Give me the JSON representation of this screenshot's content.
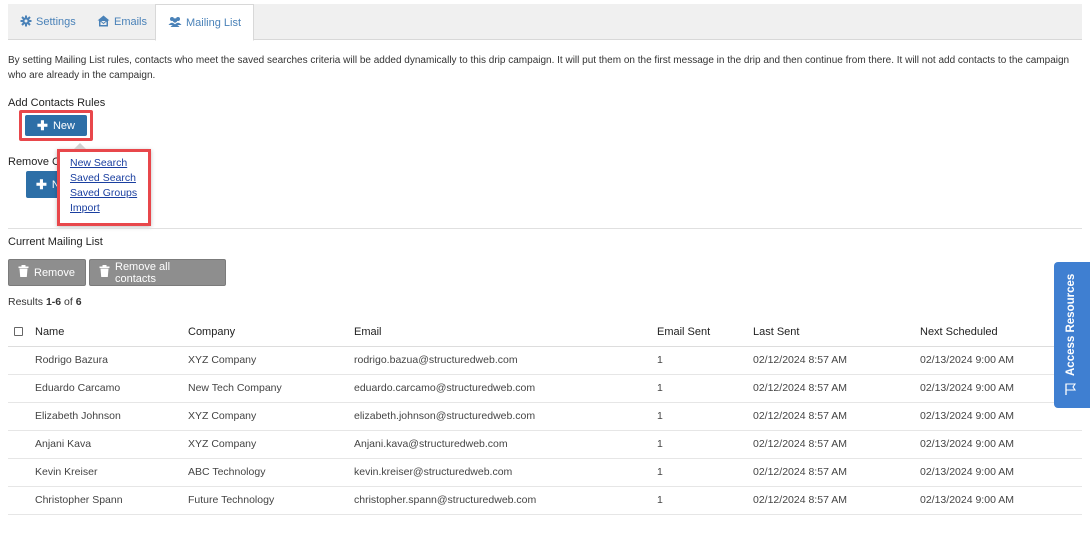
{
  "tabs": [
    {
      "label": "Settings"
    },
    {
      "label": "Emails"
    },
    {
      "label": "Mailing List"
    }
  ],
  "description": "By setting Mailing List rules, contacts who meet the saved searches criteria will be added dynamically to this drip campaign. It will put them on the first message in the drip and then continue from there. It will not add contacts to the campaign who are already in the campaign.",
  "add_rules": {
    "heading": "Add Contacts Rules",
    "new_label": "New"
  },
  "remove_rules": {
    "heading_visible": "Remove C",
    "new_label": "N"
  },
  "dropdown": {
    "items": [
      "New Search",
      "Saved Search",
      "Saved Groups",
      "Import"
    ]
  },
  "mailing_list": {
    "heading": "Current Mailing List",
    "remove_label": "Remove",
    "remove_all_label": "Remove all contacts",
    "results_prefix": "Results ",
    "results_range": "1-6",
    "results_of": " of ",
    "results_total": "6",
    "columns": [
      "Name",
      "Company",
      "Email",
      "Email Sent",
      "Last Sent",
      "Next Scheduled"
    ],
    "rows": [
      {
        "name": "Rodrigo Bazura",
        "company": "XYZ Company",
        "email": "rodrigo.bazua@structuredweb.com",
        "sent": "1",
        "last": "02/12/2024 8:57 AM",
        "next": "02/13/2024 9:00 AM"
      },
      {
        "name": "Eduardo Carcamo",
        "company": "New Tech Company",
        "email": "eduardo.carcamo@structuredweb.com",
        "sent": "1",
        "last": "02/12/2024 8:57 AM",
        "next": "02/13/2024 9:00 AM"
      },
      {
        "name": "Elizabeth Johnson",
        "company": "XYZ Company",
        "email": "elizabeth.johnson@structuredweb.com",
        "sent": "1",
        "last": "02/12/2024 8:57 AM",
        "next": "02/13/2024 9:00 AM"
      },
      {
        "name": "Anjani Kava",
        "company": "XYZ Company",
        "email": "Anjani.kava@structuredweb.com",
        "sent": "1",
        "last": "02/12/2024 8:57 AM",
        "next": "02/13/2024 9:00 AM"
      },
      {
        "name": "Kevin Kreiser",
        "company": "ABC Technology",
        "email": "kevin.kreiser@structuredweb.com",
        "sent": "1",
        "last": "02/12/2024 8:57 AM",
        "next": "02/13/2024 9:00 AM"
      },
      {
        "name": "Christopher Spann",
        "company": "Future Technology",
        "email": "christopher.spann@structuredweb.com",
        "sent": "1",
        "last": "02/12/2024 8:57 AM",
        "next": "02/13/2024 9:00 AM"
      }
    ]
  },
  "side_tab": {
    "label": "Access Resources"
  },
  "icons": {
    "settings": "gear-icon",
    "emails": "house-envelope-icon",
    "mailing_list": "users-icon",
    "new": "plus-icon",
    "remove": "trash-icon",
    "side_tab": "flag-icon"
  },
  "colors": {
    "accent_blue": "#2d6fa7",
    "tab_link": "#4a82b8",
    "highlight_red": "#e8474b",
    "gray_button": "#8e8e8e",
    "side_tab": "#3f7fd1",
    "dropdown_link": "#1a3fa0"
  }
}
